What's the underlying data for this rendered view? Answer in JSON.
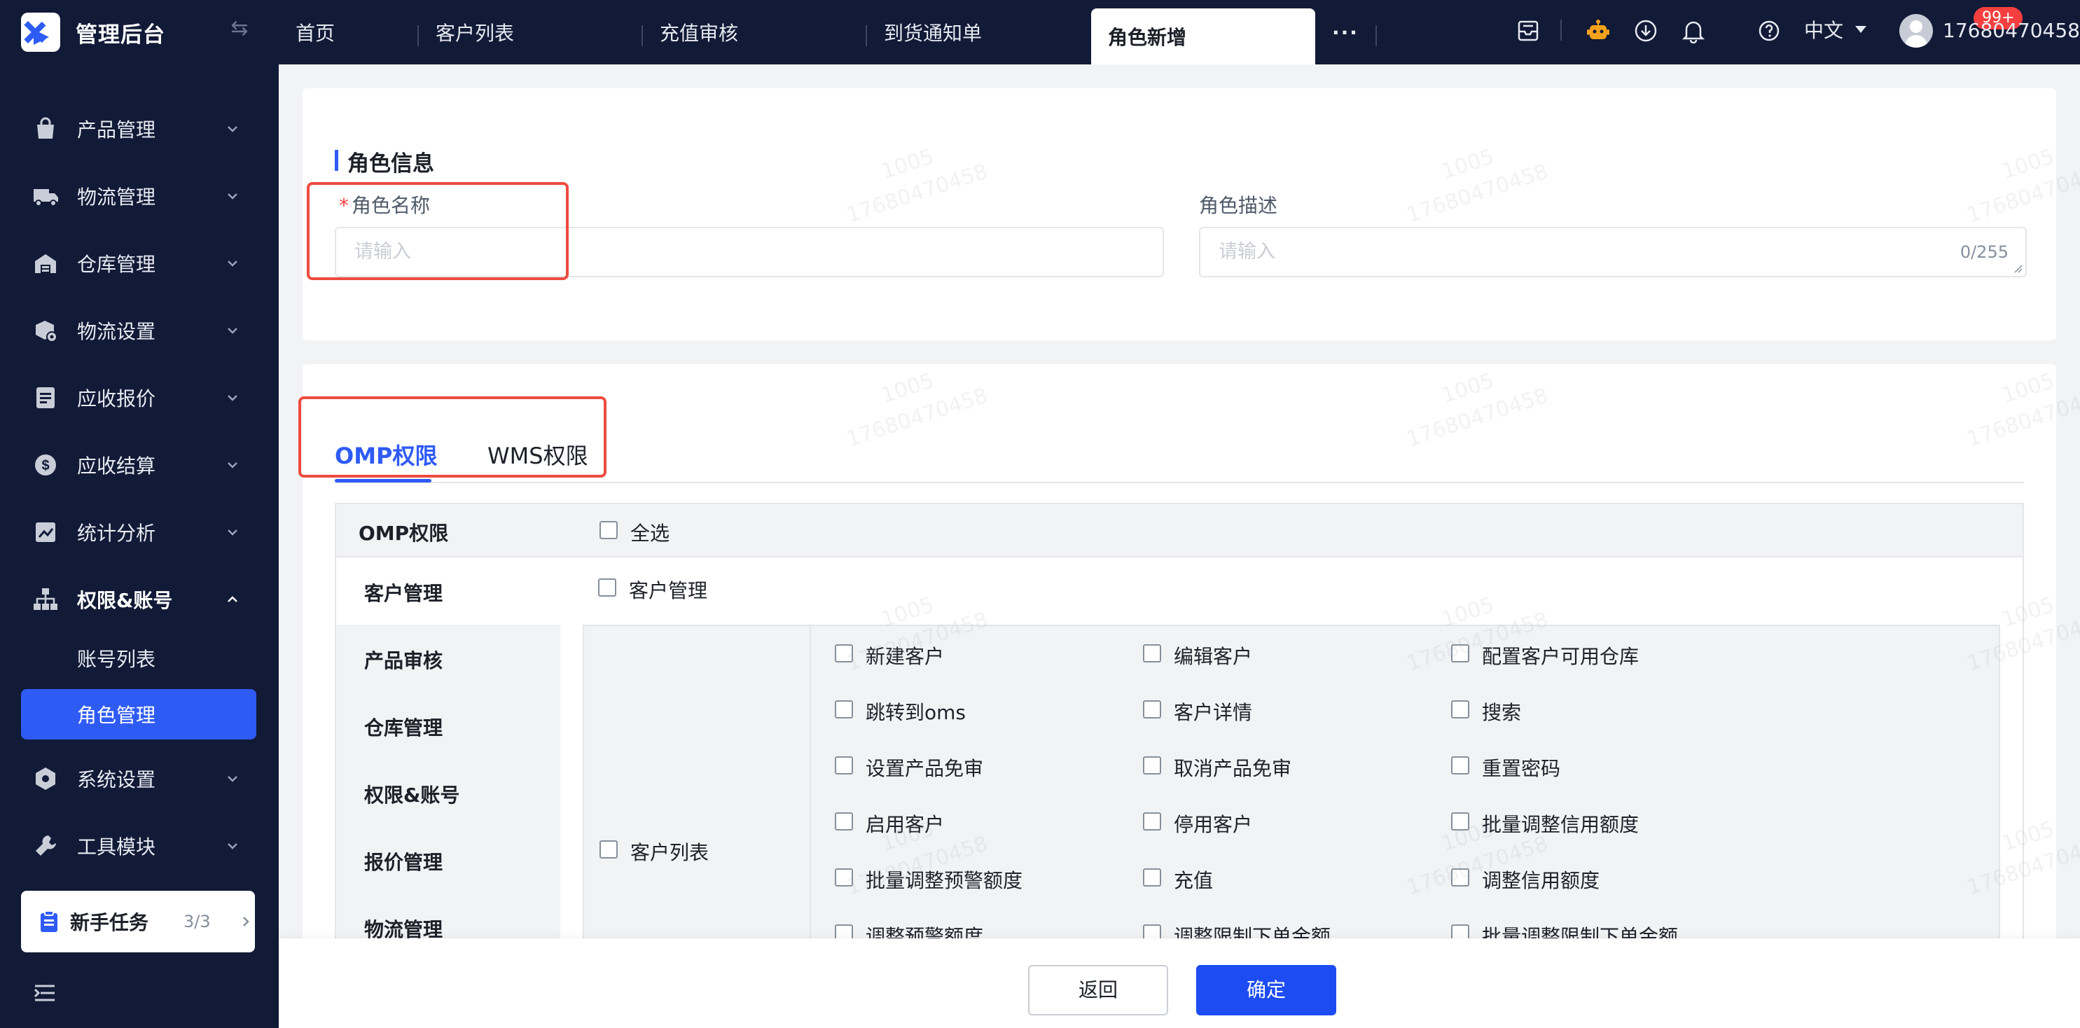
{
  "app": {
    "title": "管理后台"
  },
  "sidebar": {
    "items": [
      {
        "label": "产品管理",
        "icon": "bag-icon"
      },
      {
        "label": "物流管理",
        "icon": "truck-icon"
      },
      {
        "label": "仓库管理",
        "icon": "warehouse-icon"
      },
      {
        "label": "物流设置",
        "icon": "box-settings-icon"
      },
      {
        "label": "应收报价",
        "icon": "document-icon"
      },
      {
        "label": "应收结算",
        "icon": "dollar-icon"
      },
      {
        "label": "统计分析",
        "icon": "chart-icon"
      },
      {
        "label": "权限&账号",
        "icon": "org-chart-icon",
        "expanded": true
      },
      {
        "label": "系统设置",
        "icon": "hexagon-gear-icon"
      },
      {
        "label": "工具模块",
        "icon": "wrench-icon"
      }
    ],
    "subitems": [
      {
        "label": "账号列表",
        "active": false
      },
      {
        "label": "角色管理",
        "active": true
      }
    ],
    "task": {
      "label": "新手任务",
      "count": "3/3"
    }
  },
  "topbar": {
    "tabs": [
      "首页",
      "客户列表",
      "充值审核",
      "到货通知单",
      "角色新增"
    ],
    "active_tab": "角色新增",
    "more": "···",
    "badge": "99+",
    "language": "中文",
    "username": "17680470458"
  },
  "role_info": {
    "title": "角色信息",
    "name_label": "角色名称",
    "name_required_mark": "*",
    "name_placeholder": "请输入",
    "desc_label": "角色描述",
    "desc_placeholder": "请输入",
    "desc_counter": "0/255"
  },
  "permissions": {
    "tabs": [
      "OMP权限",
      "WMS权限"
    ],
    "active_tab": "OMP权限",
    "header_title": "OMP权限",
    "select_all": "全选",
    "modules": [
      "客户管理",
      "产品审核",
      "仓库管理",
      "权限&账号",
      "报价管理",
      "物流管理"
    ],
    "active_module": "客户管理",
    "module_checkbox": "客户管理",
    "group_label": "客户列表",
    "actions": [
      [
        "新建客户",
        "编辑客户",
        "配置客户可用仓库"
      ],
      [
        "跳转到oms",
        "客户详情",
        "搜索"
      ],
      [
        "设置产品免审",
        "取消产品免审",
        "重置密码"
      ],
      [
        "启用客户",
        "停用客户",
        "批量调整信用额度"
      ],
      [
        "批量调整预警额度",
        "充值",
        "调整信用额度"
      ],
      [
        "调整预警额度",
        "调整限制下单金额",
        "批量调整限制下单金额"
      ]
    ]
  },
  "footer": {
    "back": "返回",
    "confirm": "确定"
  },
  "watermark": {
    "line1": "1005",
    "line2": "17680470458"
  },
  "colors": {
    "primary": "#2f5bf5",
    "sidebar_bg": "#111a36",
    "highlight_box": "#ee4b3f",
    "badge": "#f53f3f"
  }
}
